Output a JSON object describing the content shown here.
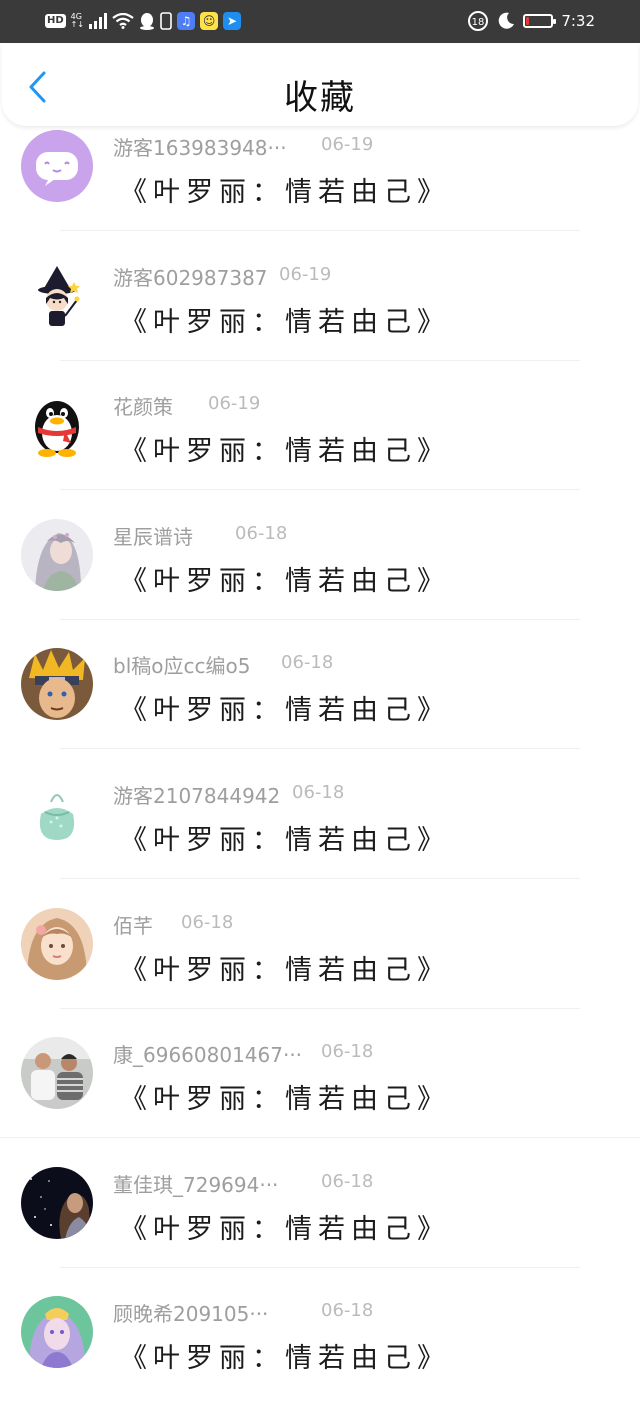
{
  "status_bar": {
    "hd": "HD",
    "net_gen": "4G",
    "net_sub": "↑↓",
    "time": "7:32",
    "battery_level": 0.1,
    "battery_color": "#e53935",
    "icons": [
      "signal-icon",
      "wifi-icon",
      "qq-icon",
      "phone-icon",
      "music-app-icon",
      "emoji-app-icon",
      "map-app-icon",
      "eye-comfort-icon",
      "moon-icon",
      "battery-icon"
    ]
  },
  "header": {
    "title": "收藏",
    "back_icon": "chevron-left-icon",
    "accent_color": "#2196f3"
  },
  "items": [
    {
      "user": "游客163983948···",
      "date": "06-19",
      "title": "《叶罗丽：情若由己》",
      "avatar": "purple-chat-bubble"
    },
    {
      "user": "游客602987387",
      "date": "06-19",
      "title": "《叶罗丽：情若由己》",
      "avatar": "witch-cartoon"
    },
    {
      "user": "花颜策",
      "date": "06-19",
      "title": "《叶罗丽：情若由己》",
      "avatar": "qq-penguin"
    },
    {
      "user": "星辰谱诗",
      "date": "06-18",
      "title": "《叶罗丽：情若由己》",
      "avatar": "anime-girl-grey-hair"
    },
    {
      "user": "bl稿o应cc编o5",
      "date": "06-18",
      "title": "《叶罗丽：情若由己》",
      "avatar": "naruto"
    },
    {
      "user": "游客2107844942",
      "date": "06-18",
      "title": "《叶罗丽：情若由己》",
      "avatar": "green-bag"
    },
    {
      "user": "佰芊",
      "date": "06-18",
      "title": "《叶罗丽：情若由己》",
      "avatar": "painted-girl"
    },
    {
      "user": "康_69660801467···",
      "date": "06-18",
      "title": "《叶罗丽：情若由己》",
      "avatar": "photo-two-people"
    },
    {
      "user": "董佳琪_729694···",
      "date": "06-18",
      "title": "《叶罗丽：情若由己》",
      "avatar": "night-sky-girl"
    },
    {
      "user": "顾晚希209105···",
      "date": "06-18",
      "title": "《叶罗丽：情若由己》",
      "avatar": "fairy-girl"
    }
  ]
}
